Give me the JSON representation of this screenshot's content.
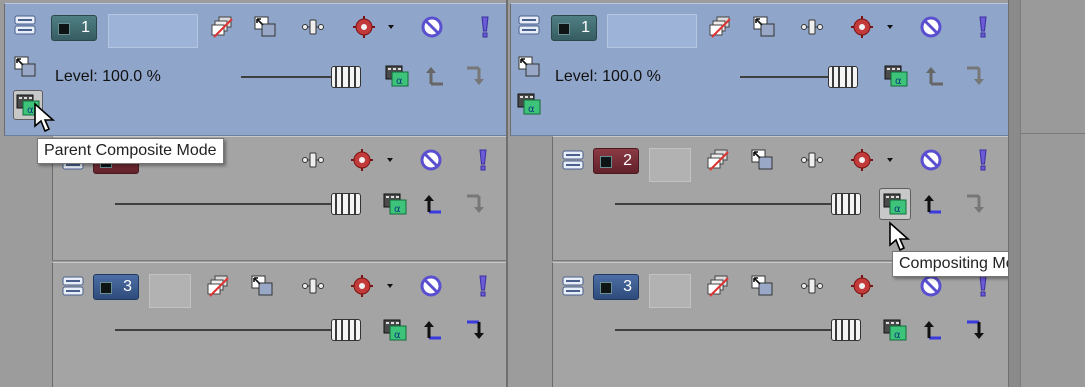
{
  "colors": {
    "parent_track_bg": "#8fa5c9",
    "child_track_bg": "#a4a4a4",
    "background": "#9c9c9c",
    "mute_icon_color": "#6b5bd6",
    "solo_icon_color": "#6b5bd6"
  },
  "icons": {
    "track_expand": "track-expand-icon",
    "make_compositing_child": "make-compositing-child-icon",
    "track_motion": "track-motion-icon",
    "bypass_motion_blur": "bypass-motion-blur-icon",
    "track_fx": "track-fx-icon",
    "mute": "mute-icon",
    "solo": "solo-icon",
    "parent_motion": "parent-motion-icon",
    "compositing_mode": "compositing-mode-icon",
    "make_child": "make-child-arrow-icon",
    "make_parent": "make-parent-arrow-icon"
  },
  "left_panel": {
    "tracks": [
      {
        "number": "1",
        "color": "teal",
        "level": "Level: 100.0 %",
        "level_fraction": 1.0
      },
      {
        "number": "",
        "color": "red",
        "level": "",
        "level_fraction": 1.0
      },
      {
        "number": "3",
        "color": "blue",
        "level": "",
        "level_fraction": 1.0
      }
    ],
    "tooltip": "Parent Composite Mode"
  },
  "right_panel": {
    "tracks": [
      {
        "number": "1",
        "color": "teal",
        "level": "Level: 100.0 %",
        "level_fraction": 1.0
      },
      {
        "number": "2",
        "color": "red",
        "level": "",
        "level_fraction": 1.0
      },
      {
        "number": "3",
        "color": "blue",
        "level": "",
        "level_fraction": 1.0
      }
    ],
    "tooltip": "Compositing Mode"
  }
}
